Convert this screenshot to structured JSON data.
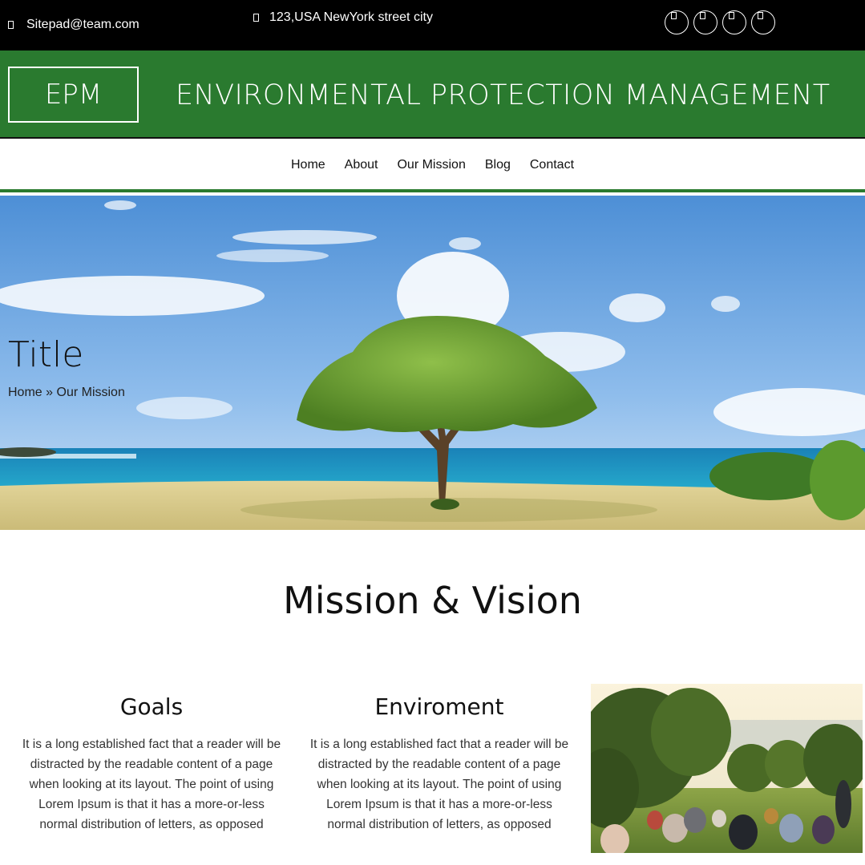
{
  "topbar": {
    "email": "Sitepad@team.com",
    "address": "123,USA NewYork street city",
    "socials": [
      "social-link-1",
      "social-link-2",
      "social-link-3",
      "social-link-4"
    ]
  },
  "header": {
    "logo": "EPM",
    "title": "ENVIRONMENTAL PROTECTION MANAGEMENT",
    "brand_color": "#2a7a2f"
  },
  "nav": {
    "items": [
      "Home",
      "About",
      "Our Mission",
      "Blog",
      "Contact"
    ]
  },
  "hero": {
    "title": "Title",
    "breadcrumb": {
      "home": "Home",
      "separator": "»",
      "current": "Our Mission"
    }
  },
  "section": {
    "title": "Mission & Vision",
    "columns": [
      {
        "heading": "Goals",
        "text": "It is a long established fact that a reader will be distracted by the readable content of a page when looking at its layout. The point of using Lorem Ipsum is that it has a more-or-less normal distribution of letters, as opposed"
      },
      {
        "heading": "Enviroment",
        "text": "It is a long established fact that a reader will be distracted by the readable content of a page when looking at its layout. The point of using Lorem Ipsum is that it has a more-or-less normal distribution of letters, as opposed"
      }
    ]
  }
}
